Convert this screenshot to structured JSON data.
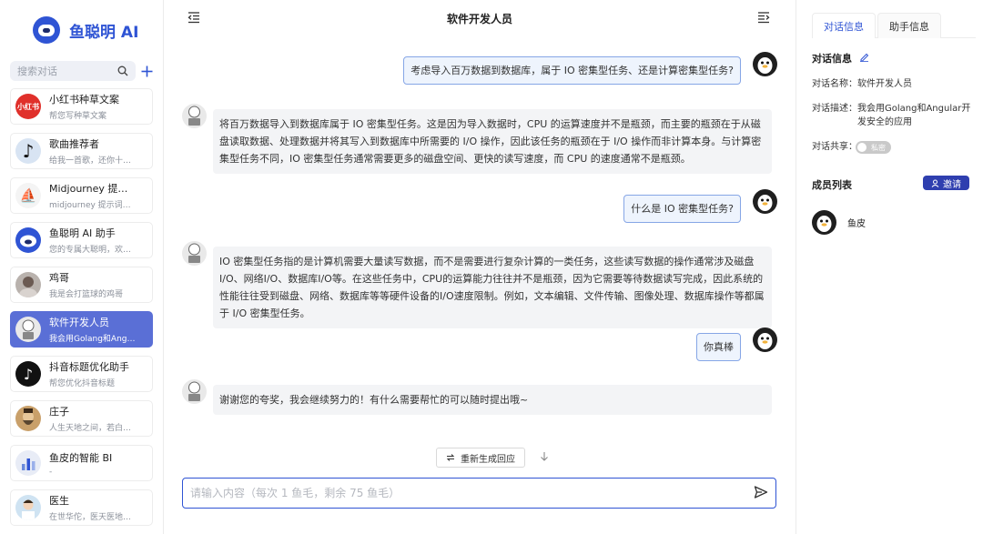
{
  "brand": {
    "name": "鱼聪明 AI"
  },
  "search": {
    "placeholder": "搜索对话"
  },
  "conversations": [
    {
      "title": "小红书种草文案",
      "desc": "帮您写种草文案",
      "avatar_text": "小红书",
      "color": "#e0302b"
    },
    {
      "title": "歌曲推荐者",
      "desc": "给我一首歌，还你十首歌",
      "avatar_text": "♪",
      "color": "#d8e4f3"
    },
    {
      "title": "Midjourney 提示词...",
      "desc": "midjourney 提示词自...",
      "avatar_text": "⛵",
      "color": "#f4f4f4"
    },
    {
      "title": "鱼聪明 AI 助手",
      "desc": "您的专属大聪明，欢迎...",
      "avatar_text": "",
      "color": "#2f54d4"
    },
    {
      "title": "鸡哥",
      "desc": "我是会打篮球的鸡哥",
      "avatar_text": "",
      "color": "#b9b2ad"
    },
    {
      "title": "软件开发人员",
      "desc": "我会用Golang和Angula...",
      "avatar_text": "",
      "color": "#e9e9e9"
    },
    {
      "title": "抖音标题优化助手",
      "desc": "帮您优化抖音标题",
      "avatar_text": "♪",
      "color": "#111111"
    },
    {
      "title": "庄子",
      "desc": "人生天地之间，若白驹...",
      "avatar_text": "",
      "color": "#c9a06a"
    },
    {
      "title": "鱼皮的智能 BI",
      "desc": "-",
      "avatar_text": "",
      "color": "#e8ecf6"
    },
    {
      "title": "医生",
      "desc": "在世华佗，医天医地医人",
      "avatar_text": "",
      "color": "#cfe3f2"
    }
  ],
  "chat": {
    "title": "软件开发人员",
    "messages": [
      {
        "role": "user",
        "text": "考虑导入百万数据到数据库，属于 IO 密集型任务、还是计算密集型任务?"
      },
      {
        "role": "bot",
        "text": "将百万数据导入到数据库属于 IO 密集型任务。这是因为导入数据时，CPU 的运算速度并不是瓶颈，而主要的瓶颈在于从磁盘读取数据、处理数据并将其写入到数据库中所需要的 I/O 操作，因此该任务的瓶颈在于 I/O 操作而非计算本身。与计算密集型任务不同，IO 密集型任务通常需要更多的磁盘空间、更快的读写速度，而 CPU 的速度通常不是瓶颈。"
      },
      {
        "role": "user",
        "text": "什么是 IO 密集型任务?"
      },
      {
        "role": "bot",
        "text": "IO 密集型任务指的是计算机需要大量读写数据，而不是需要进行复杂计算的一类任务，这些读写数据的操作通常涉及磁盘I/O、网络I/O、数据库I/O等。在这些任务中，CPU的运算能力往往并不是瓶颈，因为它需要等待数据读写完成，因此系统的性能往往受到磁盘、网络、数据库等等硬件设备的I/O速度限制。例如，文本编辑、文件传输、图像处理、数据库操作等都属于 I/O 密集型任务。"
      },
      {
        "role": "user",
        "text": "你真棒"
      },
      {
        "role": "bot",
        "text": "谢谢您的夸奖，我会继续努力的！有什么需要帮忙的可以随时提出哦~"
      }
    ],
    "regenerate_label": "重新生成回应",
    "input_placeholder": "请输入内容（每次 1 鱼毛，剩余 75 鱼毛）"
  },
  "panel": {
    "tabs": [
      "对话信息",
      "助手信息"
    ],
    "section_title": "对话信息",
    "name_label": "对话名称：",
    "name_value": "软件开发人员",
    "desc_label": "对话描述：",
    "desc_value": "我会用Golang和Angular开发安全的应用",
    "share_label": "对话共享：",
    "share_toggle": "私密",
    "members_title": "成员列表",
    "invite_label": "邀请",
    "members": [
      {
        "name": "鱼皮"
      }
    ]
  },
  "colors": {
    "accent": "#2f54d4",
    "active_item": "#5a6fd6",
    "user_bubble": "#eef4fd",
    "bot_bubble": "#f3f4f6"
  }
}
